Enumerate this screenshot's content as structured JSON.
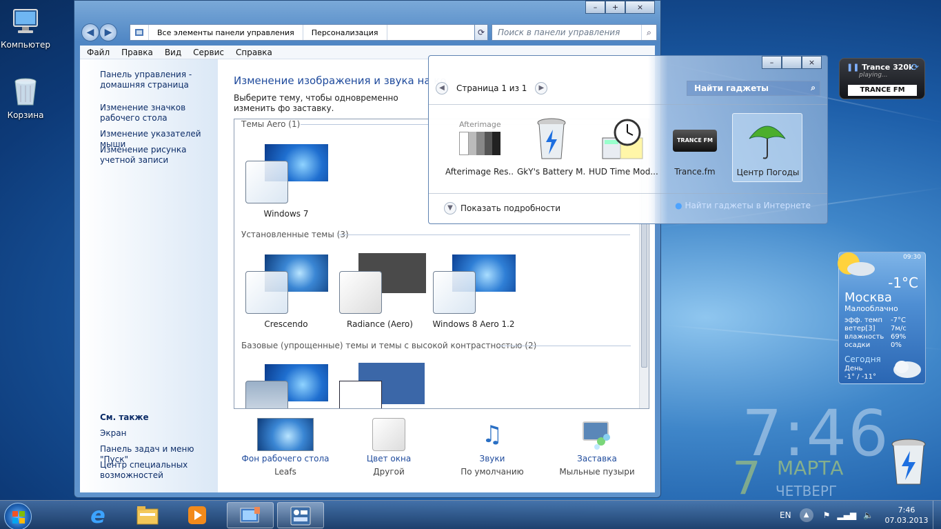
{
  "desktop": {
    "icons": [
      {
        "label": "Компьютер"
      },
      {
        "label": "Корзина"
      }
    ]
  },
  "control_panel": {
    "address": {
      "segments": [
        "Все элементы панели управления",
        "Персонализация"
      ]
    },
    "search": {
      "placeholder": "Поиск в панели управления"
    },
    "menu": [
      "Файл",
      "Правка",
      "Вид",
      "Сервис",
      "Справка"
    ],
    "left_links": [
      "Панель управления - домашняя страница",
      "Изменение значков рабочего стола",
      "Изменение указателей мыши",
      "Изменение рисунка учетной записи"
    ],
    "see_also": {
      "heading": "См. также",
      "links": [
        "Экран",
        "Панель задач и меню \"Пуск\"",
        "Центр специальных возможностей"
      ]
    },
    "title": "Изменение изображения и звука на ко",
    "description": "Выберите тему, чтобы одновременно изменить фо заставку.",
    "groups": [
      {
        "heading": "Темы Aero (1)",
        "themes": [
          "Windows 7"
        ]
      },
      {
        "heading": "Установленные темы (3)",
        "themes": [
          "Crescendo",
          "Radiance (Aero)",
          "Windows 8 Aero 1.2"
        ]
      },
      {
        "heading": "Базовые (упрощенные) темы и темы с высокой контрастностью (2)",
        "themes": []
      }
    ],
    "bottom": [
      {
        "label": "Фон рабочего стола",
        "sub": "Leafs"
      },
      {
        "label": "Цвет окна",
        "sub": "Другой"
      },
      {
        "label": "Звуки",
        "sub": "По умолчанию"
      },
      {
        "label": "Заставка",
        "sub": "Мыльные пузыри"
      }
    ]
  },
  "gadgets_window": {
    "page": "Страница 1 из 1",
    "find": "Найти гаджеты",
    "items": [
      "Afterimage Res...",
      "GkY's Battery M...",
      "HUD Time Mod...",
      "Trance.fm",
      "Центр Погоды"
    ],
    "afterimage_logo": "Afterimage",
    "trance_logo": "TRANCE FM",
    "details": "Показать подробности",
    "online": "Найти гаджеты в Интернете"
  },
  "trance_gadget": {
    "station": "Trance 320k",
    "status": "playing...",
    "logo": "TRANCE FM"
  },
  "weather": {
    "time": "09:30",
    "temp": "-1°C",
    "city": "Москва",
    "condition": "Малооблачно",
    "rows": [
      {
        "k": "эфф. темп",
        "v": "-7°C"
      },
      {
        "k": "ветер[3]",
        "v": "7м/с"
      },
      {
        "k": "влажность",
        "v": "69%"
      },
      {
        "k": "осадки",
        "v": "0%"
      }
    ],
    "today": "Сегодня",
    "day": "День",
    "range": "-1° / -11°"
  },
  "clock_gadget": {
    "time": "7:46",
    "day": "7",
    "month": "МАРТА",
    "weekday": "ЧЕТВЕРГ"
  },
  "taskbar": {
    "lang": "EN",
    "time": "7:46",
    "date": "07.03.2013"
  },
  "colors": {
    "link": "#1e4a9c",
    "nav": "#0d2d68"
  }
}
